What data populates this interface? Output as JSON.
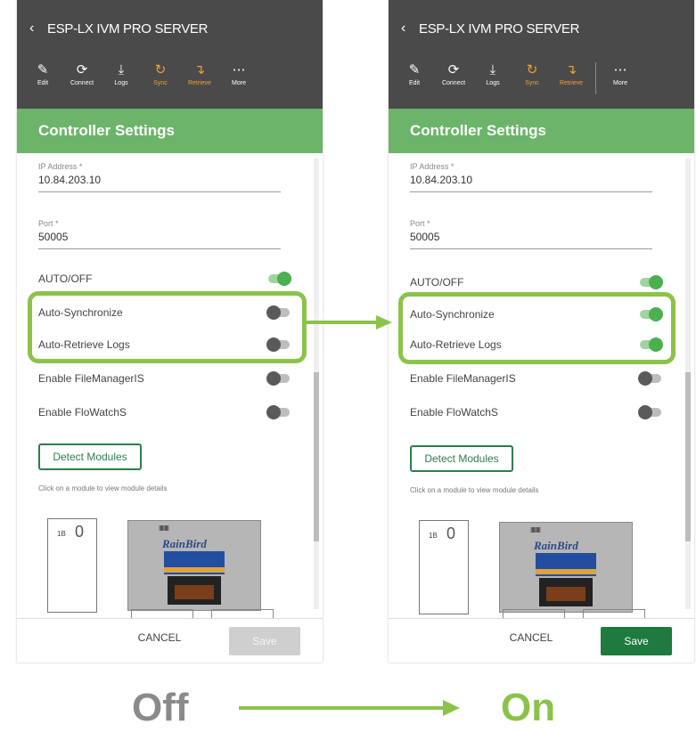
{
  "app": {
    "title": "ESP-LX IVM PRO SERVER",
    "toolbar": [
      {
        "label": "Edit",
        "icon": "pencil-icon",
        "active": false
      },
      {
        "label": "Connect",
        "icon": "connect-icon",
        "active": false
      },
      {
        "label": "Logs",
        "icon": "download-icon",
        "active": false
      },
      {
        "label": "Sync",
        "icon": "sync-icon",
        "active": true
      },
      {
        "label": "Retrieve",
        "icon": "retrieve-icon",
        "active": true
      },
      {
        "label": "More",
        "icon": "more-icon",
        "active": false
      }
    ],
    "section_title": "Controller Settings",
    "fields": {
      "ip_label": "IP Address *",
      "ip_value": "10.84.203.10",
      "port_label": "Port *",
      "port_value": "50005"
    },
    "toggles": {
      "auto_off": "AUTO/OFF",
      "auto_sync": "Auto-Synchronize",
      "auto_retrieve": "Auto-Retrieve Logs",
      "enable_filemanager": "Enable FileManagerIS",
      "enable_flowatch": "Enable FloWatchS"
    },
    "detect_button": "Detect Modules",
    "hint": "Click on a module to view module details",
    "module": {
      "slot_label": "1B",
      "slot_number": "0",
      "brand": "RainBird",
      "pins": "IIIIIIIII"
    },
    "cancel": "CANCEL",
    "save": "Save"
  },
  "states": {
    "off": {
      "auto_sync_on": false,
      "auto_retrieve_on": false,
      "save_enabled": false
    },
    "on": {
      "auto_sync_on": true,
      "auto_retrieve_on": true,
      "save_enabled": true
    }
  },
  "labels": {
    "off": "Off",
    "on": "On"
  },
  "colors": {
    "highlight": "#8bc34a",
    "header": "#4a4a4a",
    "section": "#6cb46a",
    "toggle_on": "#4caf50",
    "save_enabled": "#1e7a3e"
  }
}
